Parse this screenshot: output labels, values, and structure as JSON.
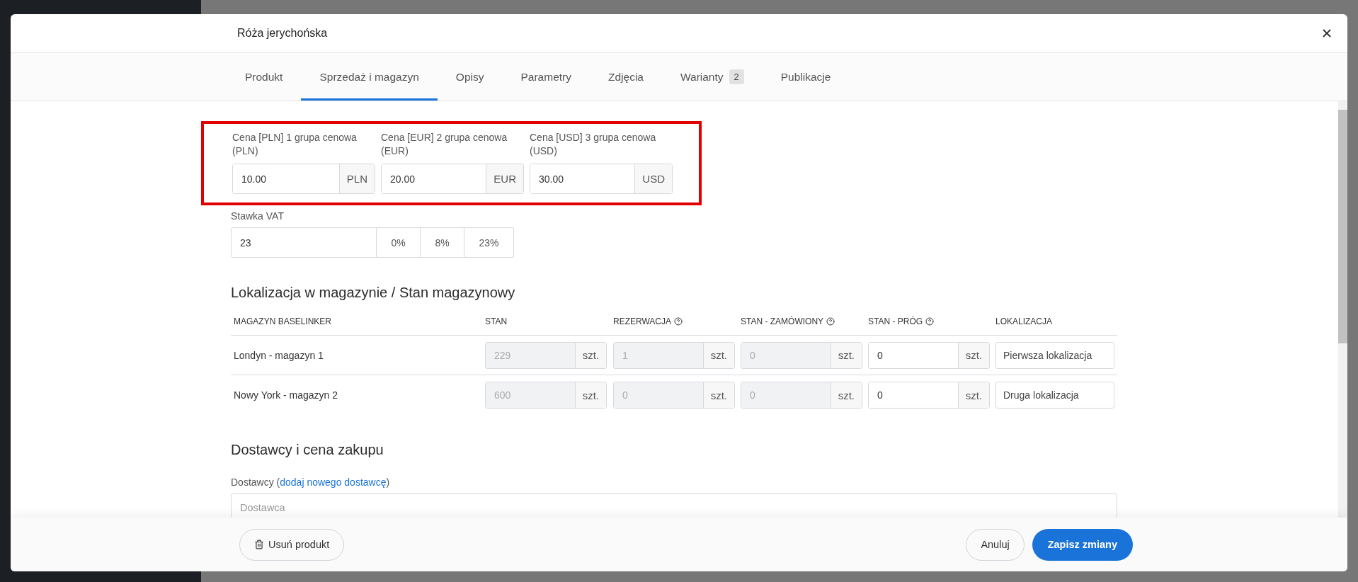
{
  "dialog": {
    "title": "Róża jerychońska"
  },
  "tabs": [
    {
      "label": "Produkt",
      "selected": false
    },
    {
      "label": "Sprzedaż i magazyn",
      "selected": true
    },
    {
      "label": "Opisy",
      "selected": false
    },
    {
      "label": "Parametry",
      "selected": false
    },
    {
      "label": "Zdjęcia",
      "selected": false
    },
    {
      "label": "Warianty",
      "badge": "2",
      "selected": false
    },
    {
      "label": "Publikacje",
      "selected": false
    }
  ],
  "prices": {
    "highlighted": true,
    "fields": [
      {
        "label": "Cena [PLN] 1 grupa cenowa (PLN)",
        "value": "10.00",
        "currency": "PLN"
      },
      {
        "label": "Cena [EUR] 2 grupa cenowa (EUR)",
        "value": "20.00",
        "currency": "EUR"
      },
      {
        "label": "Cena [USD] 3 grupa cenowa (USD)",
        "value": "30.00",
        "currency": "USD"
      }
    ]
  },
  "vat": {
    "label": "Stawka VAT",
    "value": "23",
    "options": [
      "0%",
      "8%",
      "23%"
    ]
  },
  "stock": {
    "heading": "Lokalizacja w magazynie / Stan magazynowy",
    "columns": [
      {
        "label": "MAGAZYN BASELINKER",
        "help": false
      },
      {
        "label": "STAN",
        "help": false
      },
      {
        "label": "REZERWACJA",
        "help": true
      },
      {
        "label": "STAN - ZAMÓWIONY",
        "help": true
      },
      {
        "label": "STAN - PRÓG",
        "help": true
      },
      {
        "label": "LOKALIZACJA",
        "help": false
      }
    ],
    "rows": [
      {
        "cells": [
          {
            "kind": "text",
            "value": "Londyn - magazyn 1"
          },
          {
            "kind": "quantity",
            "value": "229",
            "unit": "szt.",
            "disabled": true
          },
          {
            "kind": "quantity",
            "value": "1",
            "unit": "szt.",
            "disabled": true
          },
          {
            "kind": "quantity",
            "value": "0",
            "unit": "szt.",
            "disabled": true
          },
          {
            "kind": "quantity",
            "value": "0",
            "unit": "szt.",
            "disabled": false
          },
          {
            "kind": "location",
            "value": "Pierwsza lokalizacja"
          }
        ]
      },
      {
        "cells": [
          {
            "kind": "text",
            "value": "Nowy York - magazyn 2"
          },
          {
            "kind": "quantity",
            "value": "600",
            "unit": "szt.",
            "disabled": true
          },
          {
            "kind": "quantity",
            "value": "0",
            "unit": "szt.",
            "disabled": true
          },
          {
            "kind": "quantity",
            "value": "0",
            "unit": "szt.",
            "disabled": true
          },
          {
            "kind": "quantity",
            "value": "0",
            "unit": "szt.",
            "disabled": false
          },
          {
            "kind": "location",
            "value": "Druga lokalizacja"
          }
        ]
      }
    ]
  },
  "suppliers": {
    "heading": "Dostawcy i cena zakupu",
    "label_before": "Dostawcy (",
    "link": "dodaj nowego dostawcę",
    "label_after": ")",
    "placeholder": "Dostawca"
  },
  "footer": {
    "delete": "Usuń produkt",
    "cancel": "Anuluj",
    "save": "Zapisz zmiany"
  }
}
